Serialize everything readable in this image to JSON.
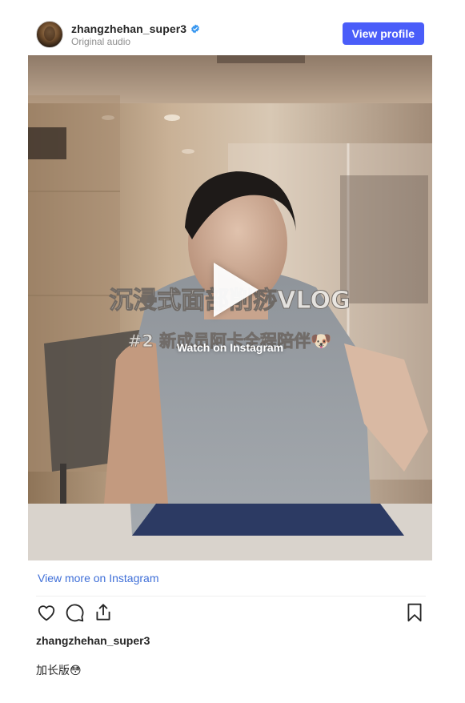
{
  "header": {
    "username": "zhangzhehan_super3",
    "audio_label": "Original audio",
    "view_profile_label": "View profile",
    "verified_color": "#3897f0"
  },
  "media": {
    "overlay_text": "Watch on Instagram",
    "burned_in_title": "沉浸式面部削痧VLOG",
    "burned_in_subtitle": "#2 新成员阿卡全程陪伴🐶"
  },
  "footer": {
    "view_more_label": "View more on Instagram",
    "owner_username": "zhangzhehan_super3",
    "caption": "加长版😳"
  },
  "icons": {
    "like": "heart-icon",
    "comment": "comment-icon",
    "share": "share-icon",
    "save": "bookmark-icon"
  },
  "colors": {
    "accent": "#4a5df9",
    "link": "#3f6fd8",
    "text": "#262626",
    "muted": "#8e8e8e"
  }
}
